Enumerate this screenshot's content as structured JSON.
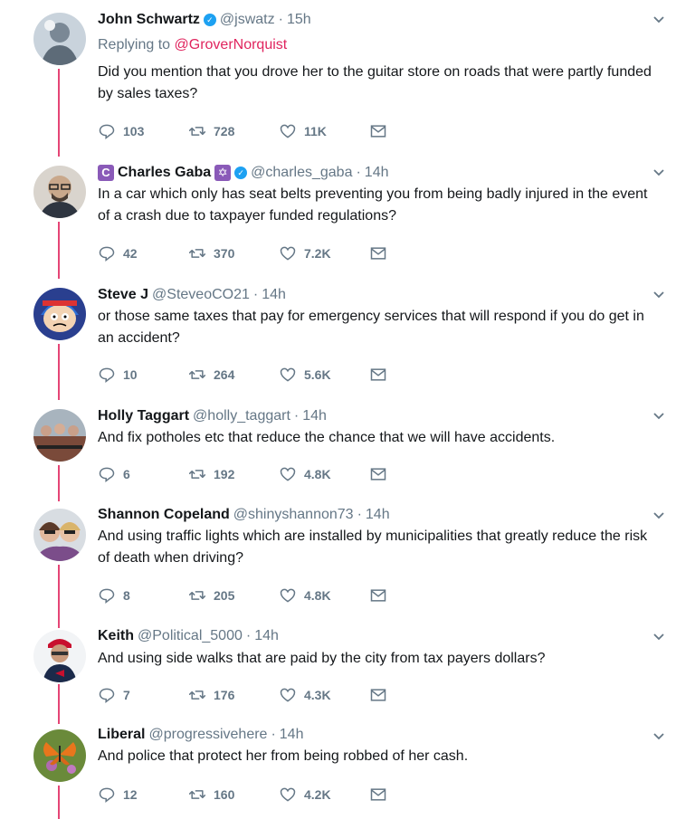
{
  "colors": {
    "thread_line": "#e0245e",
    "mention": "#e0245e",
    "verified": "#1da1f2",
    "muted": "#657786"
  },
  "tweets": [
    {
      "name": "John Schwartz",
      "handle": "@jswatz",
      "time": "15h",
      "verified": true,
      "reply_prefix": "Replying to ",
      "reply_to": "@GroverNorquist",
      "text": "Did you mention that you drove her to the guitar store on roads that were partly funded by sales taxes?",
      "replies": "103",
      "retweets": "728",
      "likes": "11K"
    },
    {
      "name": "Charles Gaba",
      "handle": "@charles_gaba",
      "time": "14h",
      "verified": true,
      "name_prefix_badge": "C",
      "name_suffix_badge": "✡",
      "text": "In a car which only has seat belts preventing you from being badly injured in the event of a crash due to taxpayer funded regulations?",
      "replies": "42",
      "retweets": "370",
      "likes": "7.2K"
    },
    {
      "name": "Steve J",
      "handle": "@SteveoCO21",
      "time": "14h",
      "text": "or those same taxes that pay for emergency services that will respond if you do get in an accident?",
      "replies": "10",
      "retweets": "264",
      "likes": "5.6K"
    },
    {
      "name": "Holly Taggart",
      "handle": "@holly_taggart",
      "time": "14h",
      "text": "And fix potholes etc that reduce the chance that we will have accidents.",
      "replies": "6",
      "retweets": "192",
      "likes": "4.8K"
    },
    {
      "name": "Shannon Copeland",
      "handle": "@shinyshannon73",
      "time": "14h",
      "text": "And using traffic lights which are installed by municipalities that greatly reduce the risk of death when driving?",
      "replies": "8",
      "retweets": "205",
      "likes": "4.8K"
    },
    {
      "name": "Keith",
      "handle": "@Political_5000",
      "time": "14h",
      "text": "And using side walks that are paid by the city from tax payers dollars?",
      "replies": "7",
      "retweets": "176",
      "likes": "4.3K"
    },
    {
      "name": "Liberal",
      "handle": "@progressivehere",
      "time": "14h",
      "text": "And police that protect her from being robbed of her cash.",
      "replies": "12",
      "retweets": "160",
      "likes": "4.2K"
    }
  ],
  "icons": {
    "reply": "reply-icon",
    "retweet": "retweet-icon",
    "like": "heart-icon",
    "dm": "envelope-icon",
    "more": "chevron-down-icon"
  }
}
